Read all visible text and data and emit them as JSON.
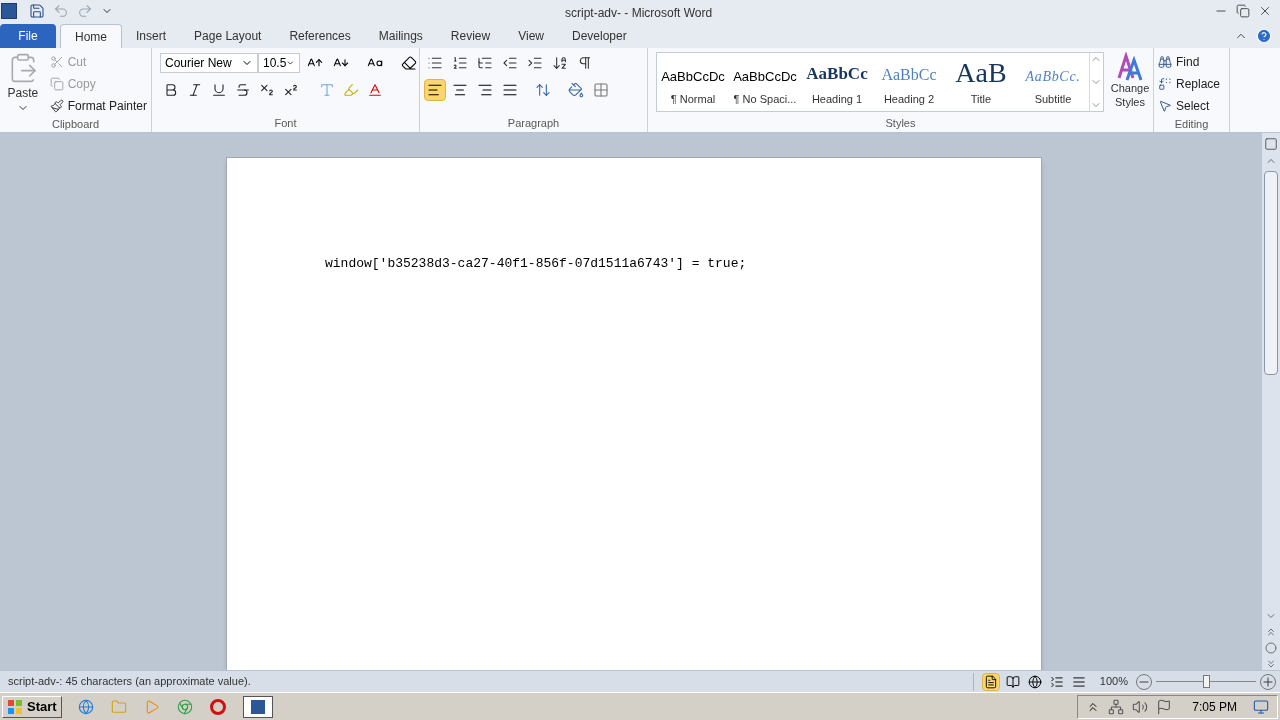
{
  "window": {
    "title": "script-adv-  -  Microsoft Word"
  },
  "tabs": [
    {
      "label": "File",
      "kind": "file",
      "selected": false
    },
    {
      "label": "Home",
      "kind": "tab",
      "selected": true
    },
    {
      "label": "Insert",
      "kind": "tab",
      "selected": false
    },
    {
      "label": "Page Layout",
      "kind": "tab",
      "selected": false
    },
    {
      "label": "References",
      "kind": "tab",
      "selected": false
    },
    {
      "label": "Mailings",
      "kind": "tab",
      "selected": false
    },
    {
      "label": "Review",
      "kind": "tab",
      "selected": false
    },
    {
      "label": "View",
      "kind": "tab",
      "selected": false
    },
    {
      "label": "Developer",
      "kind": "tab",
      "selected": false
    }
  ],
  "clipboard": {
    "label": "Clipboard",
    "paste": "Paste",
    "items": [
      {
        "label": "Cut",
        "disabled": true
      },
      {
        "label": "Copy",
        "disabled": true
      },
      {
        "label": "Format Painter",
        "disabled": false
      }
    ]
  },
  "font": {
    "label": "Font",
    "family": "Courier New",
    "size": "10.5"
  },
  "paragraph": {
    "label": "Paragraph",
    "alignments": [
      {
        "kind": "left",
        "selected": true
      },
      {
        "kind": "center",
        "selected": false
      },
      {
        "kind": "right",
        "selected": false
      },
      {
        "kind": "justify",
        "selected": false
      }
    ]
  },
  "styles": {
    "label": "Styles",
    "items": [
      {
        "preview": "AaBbCcDc",
        "name": "¶ Normal",
        "kind": "normal"
      },
      {
        "preview": "AaBbCcDc",
        "name": "¶ No Spaci...",
        "kind": "normal"
      },
      {
        "preview": "AaBbCc",
        "name": "Heading 1",
        "kind": "heading1"
      },
      {
        "preview": "AaBbCc",
        "name": "Heading 2",
        "kind": "heading2"
      },
      {
        "preview": "AaB",
        "name": "Title",
        "kind": "title"
      },
      {
        "preview": "AaBbCc.",
        "name": "Subtitle",
        "kind": "subtitle"
      }
    ],
    "change_styles": "Change Styles"
  },
  "editing": {
    "label": "Editing",
    "items": [
      {
        "label": "Find",
        "kind": "find"
      },
      {
        "label": "Replace",
        "kind": "replace"
      },
      {
        "label": "Select",
        "kind": "select"
      }
    ]
  },
  "document": {
    "lines": [
      "window['b35238d3-ca27-40f1-856f-07d1511a6743'] = true;"
    ]
  },
  "status_bar": {
    "text": "script-adv-: 45 characters (an approximate value).",
    "views": [
      {
        "kind": "print",
        "selected": true
      },
      {
        "kind": "reading",
        "selected": false
      },
      {
        "kind": "web",
        "selected": false
      },
      {
        "kind": "outline",
        "selected": false
      },
      {
        "kind": "draft",
        "selected": false
      }
    ],
    "zoom": "100%",
    "zoom_slider": {
      "level": 0.5
    }
  },
  "taskbar": {
    "start": "Start",
    "clock": "7:05 PM"
  }
}
